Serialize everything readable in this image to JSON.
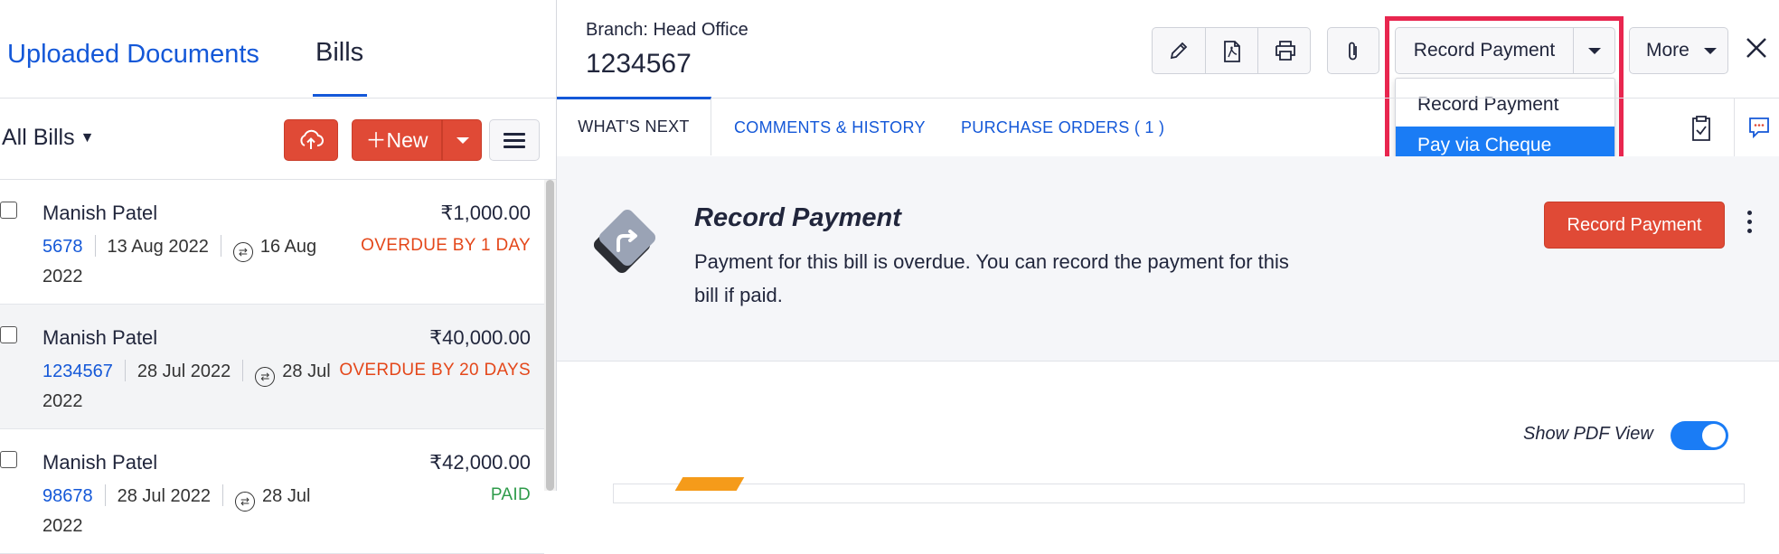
{
  "left": {
    "tabs": {
      "uploaded": "Uploaded Documents",
      "bills": "Bills"
    },
    "filter": {
      "label": "All Bills"
    },
    "new_button": "New",
    "bills": [
      {
        "vendor": "Manish Patel",
        "amount": "₹1,000.00",
        "number": "5678",
        "date": "13 Aug 2022",
        "due_date": "16 Aug 2022",
        "status": "OVERDUE BY 1 DAY"
      },
      {
        "vendor": "Manish Patel",
        "amount": "₹40,000.00",
        "number": "1234567",
        "date": "28 Jul 2022",
        "due_date": "28 Jul 2022",
        "status": "OVERDUE BY 20 DAYS"
      },
      {
        "vendor": "Manish Patel",
        "amount": "₹42,000.00",
        "number": "98678",
        "date": "28 Jul 2022",
        "due_date": "28 Jul 2022",
        "status": "PAID"
      }
    ]
  },
  "detail": {
    "branch": "Branch: Head Office",
    "bill_number": "1234567",
    "record_payment_label": "Record Payment",
    "dropdown_options": [
      "Record Payment",
      "Pay via Cheque"
    ],
    "selected_option": "Pay via Cheque",
    "more_label": "More",
    "tabs": [
      "WHAT'S NEXT",
      "COMMENTS & HISTORY",
      "PURCHASE ORDERS ( 1 )"
    ],
    "whats_next": {
      "title": "Record Payment",
      "description": "Payment for this bill is overdue. You can record the payment for this bill if paid.",
      "button": "Record Payment"
    },
    "pdf_toggle_label": "Show PDF View",
    "pdf_view_enabled": true
  },
  "colors": {
    "accent_blue": "#1458d8",
    "brand_red": "#e04a36",
    "highlight_pink": "#e8264f",
    "overdue_orange": "#e4471a",
    "toggle_blue": "#1a7cf5"
  },
  "icons": [
    "upload-cloud-icon",
    "menu-icon",
    "pencil-icon",
    "pdf-icon",
    "printer-icon",
    "paperclip-icon",
    "close-icon",
    "clipboard-check-icon",
    "chat-icon",
    "redirect-arrow-icon",
    "kebab-icon",
    "repeat-icon"
  ]
}
